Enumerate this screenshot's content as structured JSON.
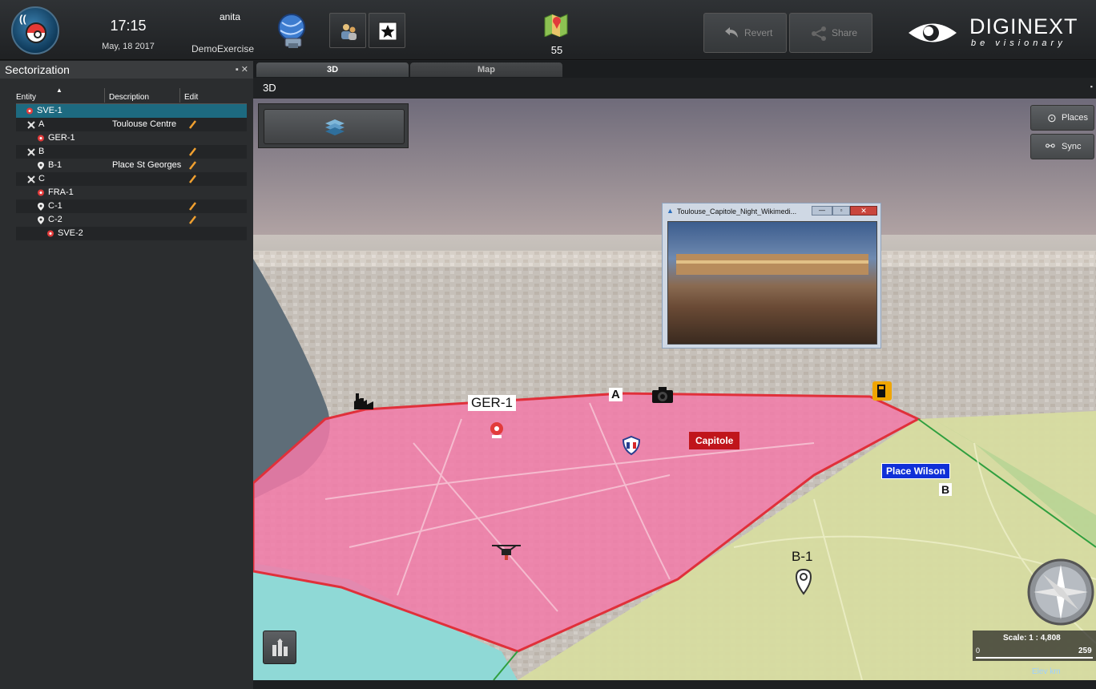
{
  "header": {
    "time": "17:15",
    "date": "May, 18 2017",
    "user": "anita",
    "exercise": "DemoExercise",
    "map_count": "55",
    "revert_label": "Revert",
    "share_label": "Share",
    "brand_name": "DIGINEXT",
    "brand_tagline": "be visionary"
  },
  "panel": {
    "title": "Sectorization",
    "columns": [
      "Entity",
      "Description",
      "Edit"
    ],
    "rows": [
      {
        "entity": "SVE-1",
        "description": "",
        "icon": "drone-marker-icon",
        "editable": false
      },
      {
        "entity": "A",
        "description": "Toulouse Centre",
        "icon": "sector-icon",
        "editable": true
      },
      {
        "entity": "GER-1",
        "description": "",
        "icon": "drone-marker-icon",
        "editable": false
      },
      {
        "entity": "B",
        "description": "",
        "icon": "sector-icon",
        "editable": true
      },
      {
        "entity": "B-1",
        "description": "Place St Georges",
        "icon": "pin-icon",
        "editable": true
      },
      {
        "entity": "C",
        "description": "",
        "icon": "sector-icon",
        "editable": true
      },
      {
        "entity": "FRA-1",
        "description": "",
        "icon": "drone-marker-icon",
        "editable": false
      },
      {
        "entity": "C-1",
        "description": "",
        "icon": "pin-icon",
        "editable": true
      },
      {
        "entity": "C-2",
        "description": "",
        "icon": "pin-icon",
        "editable": true
      },
      {
        "entity": "SVE-2",
        "description": "",
        "icon": "drone-marker-icon",
        "editable": false
      }
    ]
  },
  "tabs": [
    "3D",
    "Map"
  ],
  "view": {
    "title": "3D",
    "places_label": "Places",
    "sync_label": "Sync",
    "popup_title": "Toulouse_Capitole_Night_Wikimedi...",
    "labels": {
      "ger1": "GER-1",
      "a": "A",
      "capitole": "Capitole",
      "place_wilson": "Place Wilson",
      "b": "B",
      "b1": "B-1"
    },
    "scale_text": "Scale: 1 : 4,808",
    "scale_zero": "0",
    "scale_end": "259",
    "elev_text": "Elev  km"
  },
  "colors": {
    "sector_a": "#f27aa8",
    "sector_border": "#e0303a",
    "sector_b": "#d7dca0",
    "selected_row": "#1d6a80",
    "capitole_label": "#c0151b",
    "wilson_label": "#1030d8"
  }
}
